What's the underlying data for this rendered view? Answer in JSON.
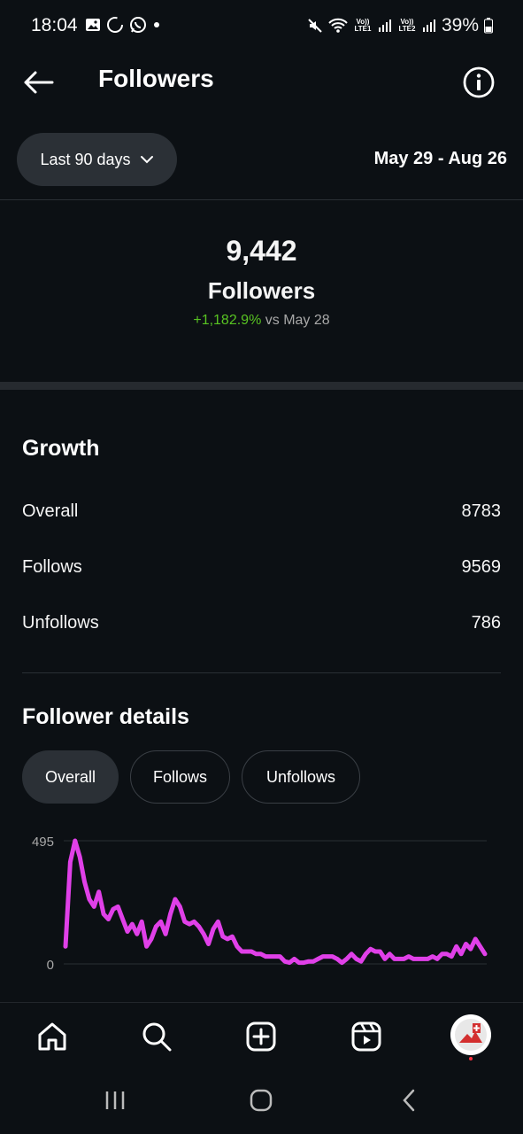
{
  "status_bar": {
    "time": "18:04",
    "battery": "39%",
    "sim1": "Vo)) LTE1",
    "sim2": "Vo)) LTE2"
  },
  "header": {
    "title": "Followers"
  },
  "filter": {
    "range_label": "Last 90 days",
    "date_range": "May 29 - Aug 26"
  },
  "summary": {
    "total": "9,442",
    "label": "Followers",
    "delta": "+1,182.9%",
    "delta_suffix": " vs May 28"
  },
  "growth": {
    "title": "Growth",
    "rows": [
      {
        "label": "Overall",
        "value": "8783"
      },
      {
        "label": "Follows",
        "value": "9569"
      },
      {
        "label": "Unfollows",
        "value": "786"
      }
    ]
  },
  "details": {
    "title": "Follower details",
    "tabs": [
      "Overall",
      "Follows",
      "Unfollows"
    ],
    "active_tab": "Overall"
  },
  "chart_data": {
    "type": "line",
    "ylim": [
      0,
      495
    ],
    "y_ticks": [
      "495",
      "0"
    ],
    "color": "#e040e8",
    "values": [
      70,
      410,
      495,
      430,
      330,
      260,
      230,
      290,
      200,
      180,
      220,
      230,
      180,
      130,
      160,
      120,
      170,
      70,
      100,
      150,
      170,
      120,
      200,
      260,
      230,
      170,
      160,
      170,
      150,
      120,
      80,
      140,
      170,
      110,
      100,
      110,
      70,
      50,
      50,
      50,
      40,
      40,
      30,
      30,
      30,
      30,
      10,
      5,
      20,
      5,
      5,
      10,
      10,
      20,
      30,
      30,
      30,
      20,
      5,
      20,
      40,
      20,
      10,
      40,
      60,
      50,
      50,
      20,
      40,
      20,
      20,
      20,
      30,
      20,
      20,
      20,
      20,
      30,
      20,
      40,
      40,
      30,
      70,
      40,
      80,
      60,
      100,
      70,
      40
    ]
  },
  "colors": {
    "background": "#0c1014",
    "accent_positive": "#58c322",
    "chart_line": "#e040e8"
  }
}
